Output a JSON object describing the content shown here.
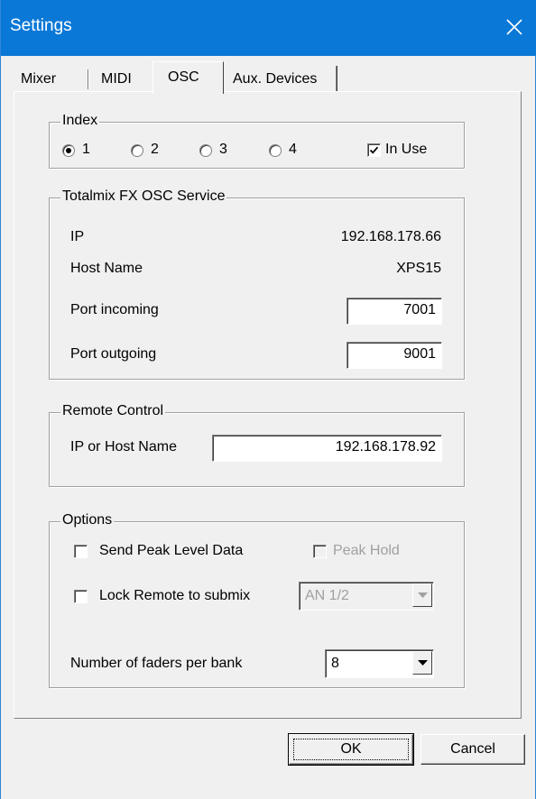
{
  "window": {
    "title": "Settings",
    "close_icon": "close-icon"
  },
  "tabs": [
    {
      "label": "Mixer",
      "active": false
    },
    {
      "label": "MIDI",
      "active": false
    },
    {
      "label": "OSC",
      "active": true
    },
    {
      "label": "Aux. Devices",
      "active": false
    }
  ],
  "index": {
    "legend": "Index",
    "radios": [
      {
        "label": "1",
        "selected": true
      },
      {
        "label": "2",
        "selected": false
      },
      {
        "label": "3",
        "selected": false
      },
      {
        "label": "4",
        "selected": false
      }
    ],
    "in_use": {
      "label": "In Use",
      "checked": true
    }
  },
  "service": {
    "legend": "Totalmix FX OSC Service",
    "ip_label": "IP",
    "ip_value": "192.168.178.66",
    "host_label": "Host Name",
    "host_value": "XPS15",
    "port_in_label": "Port incoming",
    "port_in_value": "7001",
    "port_out_label": "Port outgoing",
    "port_out_value": "9001"
  },
  "remote": {
    "legend": "Remote Control",
    "host_label": "IP or Host Name",
    "host_value": "192.168.178.92"
  },
  "options": {
    "legend": "Options",
    "send_peak": {
      "label": "Send Peak Level Data",
      "checked": false
    },
    "peak_hold": {
      "label": "Peak Hold",
      "checked": false,
      "disabled": true
    },
    "lock_remote": {
      "label": "Lock Remote to submix",
      "checked": false
    },
    "submix_value": "AN 1/2",
    "faders_label": "Number of faders per bank",
    "faders_value": "8"
  },
  "buttons": {
    "ok": "OK",
    "cancel": "Cancel"
  }
}
